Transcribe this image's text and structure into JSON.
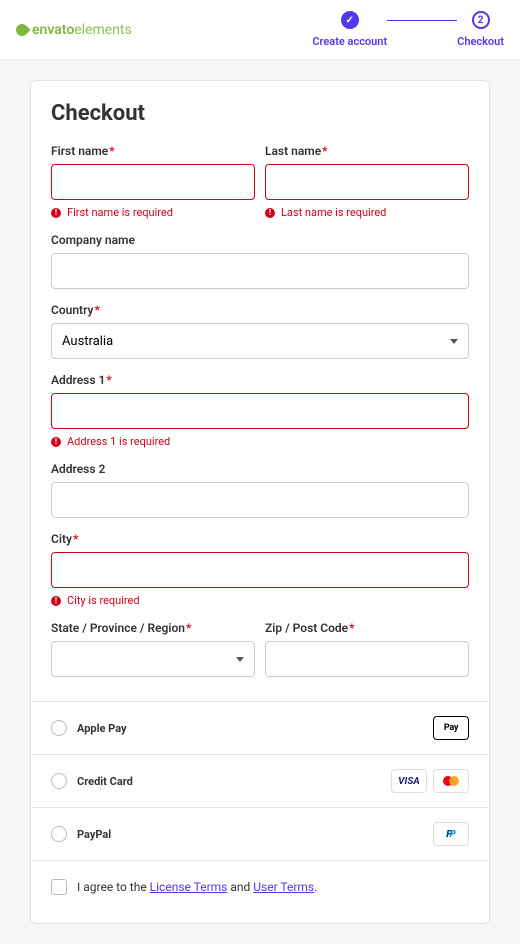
{
  "logo": {
    "brand": "envato",
    "product": "elements"
  },
  "steps": [
    {
      "label": "Create account",
      "state": "done"
    },
    {
      "label": "Checkout",
      "state": "current",
      "num": "2"
    }
  ],
  "title": "Checkout",
  "fields": {
    "first_name": {
      "label": "First name",
      "required": true,
      "error": "First name is required"
    },
    "last_name": {
      "label": "Last name",
      "required": true,
      "error": "Last name is required"
    },
    "company": {
      "label": "Company name",
      "required": false
    },
    "country": {
      "label": "Country",
      "required": true,
      "value": "Australia"
    },
    "address1": {
      "label": "Address 1",
      "required": true,
      "error": "Address 1 is required"
    },
    "address2": {
      "label": "Address 2",
      "required": false
    },
    "city": {
      "label": "City",
      "required": true,
      "error": "City is required"
    },
    "state": {
      "label": "State / Province / Region",
      "required": true
    },
    "zip": {
      "label": "Zip / Post Code",
      "required": true
    }
  },
  "required_marker": "*",
  "payment_methods": [
    {
      "name": "Apple Pay",
      "badges": [
        "applepay"
      ]
    },
    {
      "name": "Credit Card",
      "badges": [
        "visa",
        "mastercard"
      ]
    },
    {
      "name": "PayPal",
      "badges": [
        "paypal"
      ]
    }
  ],
  "agree": {
    "prefix": "I agree to the ",
    "license_link": "License Terms",
    "middle": " and ",
    "user_link": "User Terms",
    "suffix": "."
  }
}
